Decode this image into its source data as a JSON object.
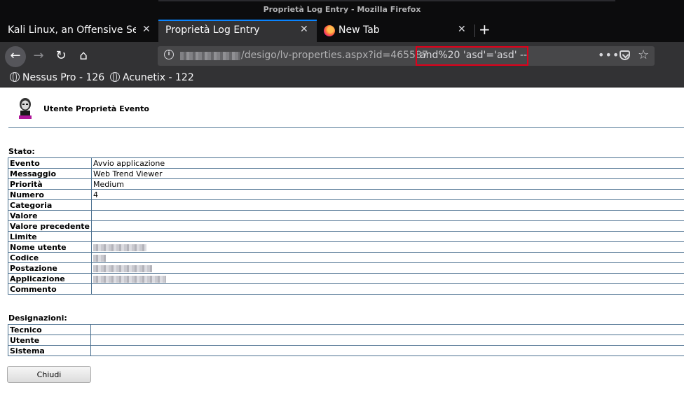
{
  "window": {
    "title": "Proprietà Log Entry - Mozilla Firefox"
  },
  "tabs": [
    {
      "label": "Kali Linux, an Offensive Security"
    },
    {
      "label": "Proprietà Log Entry"
    },
    {
      "label": "New Tab"
    }
  ],
  "urlbar": {
    "path": "/desigo/lv-properties.aspx?id=465587",
    "injected": "and%20 'asd'='asd' --"
  },
  "bookmarks": [
    {
      "label": "Nessus Pro - 126"
    },
    {
      "label": "Acunetix - 122"
    }
  ],
  "page": {
    "title": "Utente Proprietà Evento",
    "stato_label": "Stato:",
    "stato_rows": [
      {
        "key": "Evento",
        "value": "Avvio applicazione"
      },
      {
        "key": "Messaggio",
        "value": "Web Trend Viewer"
      },
      {
        "key": "Priorità",
        "value": "Medium"
      },
      {
        "key": "Numero",
        "value": "4"
      },
      {
        "key": "Categoria",
        "value": ""
      },
      {
        "key": "Valore",
        "value": ""
      },
      {
        "key": "Valore precedente",
        "value": ""
      },
      {
        "key": "Limite",
        "value": ""
      },
      {
        "key": "Nome utente",
        "value": ""
      },
      {
        "key": "Codice",
        "value": ""
      },
      {
        "key": "Postazione",
        "value": ""
      },
      {
        "key": "Applicazione",
        "value": ""
      },
      {
        "key": "Commento",
        "value": ""
      }
    ],
    "designazioni_label": "Designazioni:",
    "designazioni_rows": [
      {
        "key": "Tecnico",
        "value": ""
      },
      {
        "key": "Utente",
        "value": ""
      },
      {
        "key": "Sistema",
        "value": ""
      }
    ],
    "close_button": "Chiudi"
  }
}
